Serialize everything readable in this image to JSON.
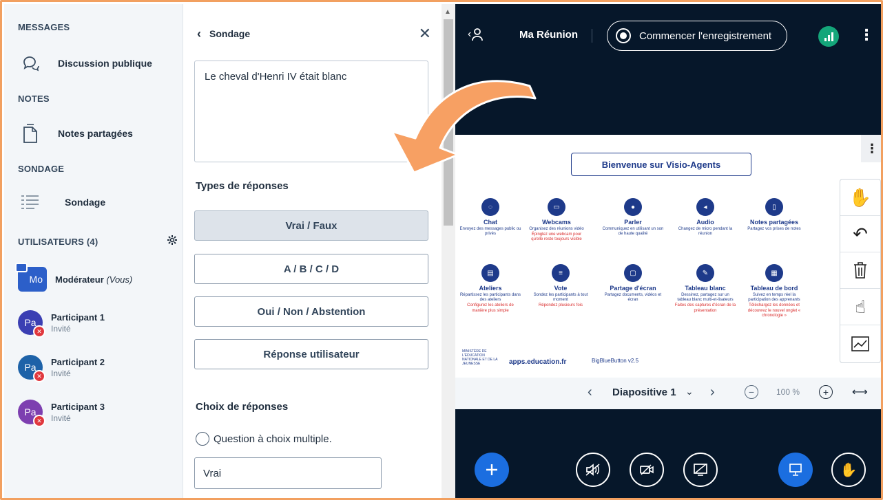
{
  "sidebar": {
    "messages_title": "MESSAGES",
    "public_chat": "Discussion publique",
    "notes_title": "NOTES",
    "shared_notes": "Notes partagées",
    "poll_title": "SONDAGE",
    "poll_item": "Sondage",
    "users_title": "UTILISATEURS (4)",
    "users": [
      {
        "initials": "Mo",
        "name": "Modérateur",
        "suffix": "(Vous)",
        "role": "",
        "color": "#2c5fc9"
      },
      {
        "initials": "Pa",
        "name": "Participant 1",
        "role": "Invité",
        "color": "#3b3fb3"
      },
      {
        "initials": "Pa",
        "name": "Participant 2",
        "role": "Invité",
        "color": "#1d62a8"
      },
      {
        "initials": "Pa",
        "name": "Participant 3",
        "role": "Invité",
        "color": "#7d3fb0"
      }
    ]
  },
  "poll": {
    "back_label": "Sondage",
    "question": "Le cheval d'Henri IV était blanc",
    "types_title": "Types de réponses",
    "types": [
      "Vrai / Faux",
      "A / B / C / D",
      "Oui / Non / Abstention",
      "Réponse utilisateur"
    ],
    "selected_type": "Vrai / Faux",
    "choices_title": "Choix de réponses",
    "multiple_choice": "Question à choix multiple.",
    "answer_value": "Vrai"
  },
  "meeting": {
    "title": "Ma Réunion",
    "record_label": "Commencer l'enregistrement",
    "slide": {
      "title": "Bienvenue sur Visio-Agents",
      "features_row1": [
        {
          "name": "Chat",
          "desc": "Envoyez des messages public ou privés",
          "note": ""
        },
        {
          "name": "Webcams",
          "desc": "Organisez des réunions vidéo",
          "note": "Épinglez une webcam pour qu'elle reste toujours visible"
        },
        {
          "name": "Parler",
          "desc": "Communiquez en utilisant un son de haute qualité",
          "note": ""
        },
        {
          "name": "Audio",
          "desc": "Changez de micro pendant la réunion",
          "note": ""
        },
        {
          "name": "Notes partagées",
          "desc": "Partagez vos prises de notes",
          "note": ""
        }
      ],
      "features_row2": [
        {
          "name": "Ateliers",
          "desc": "Répartissez les participants dans des ateliers",
          "note": "Configurez les ateliers de manière plus simple"
        },
        {
          "name": "Vote",
          "desc": "Sondez les participants à tout moment",
          "note": "Répondez plusieurs fois"
        },
        {
          "name": "Partage d'écran",
          "desc": "Partagez documents, vidéos et écran",
          "note": ""
        },
        {
          "name": "Tableau blanc",
          "desc": "Dessinez, partagez sur un tableau blanc multi-et-lisateurs",
          "note": "Faites des captures d'écran de la présentation"
        },
        {
          "name": "Tableau de bord",
          "desc": "Suivez en temps réel la participation des apprenants",
          "note": "Téléchargez les données et découvrez le nouvel onglet « chronologie »"
        }
      ],
      "ministry": "MINISTÈRE DE L'ÉDUCATION NATIONALE ET DE LA JEUNESSE",
      "apps": "apps.education.fr",
      "bbb": "BigBlueButton v2.5"
    },
    "slide_label": "Diapositive 1",
    "zoom": "100 %"
  },
  "colors": {
    "accent": "#1b6ee0",
    "meeting_bg": "#06172a",
    "arrow": "#f7a063",
    "connection": "#14a67a"
  }
}
